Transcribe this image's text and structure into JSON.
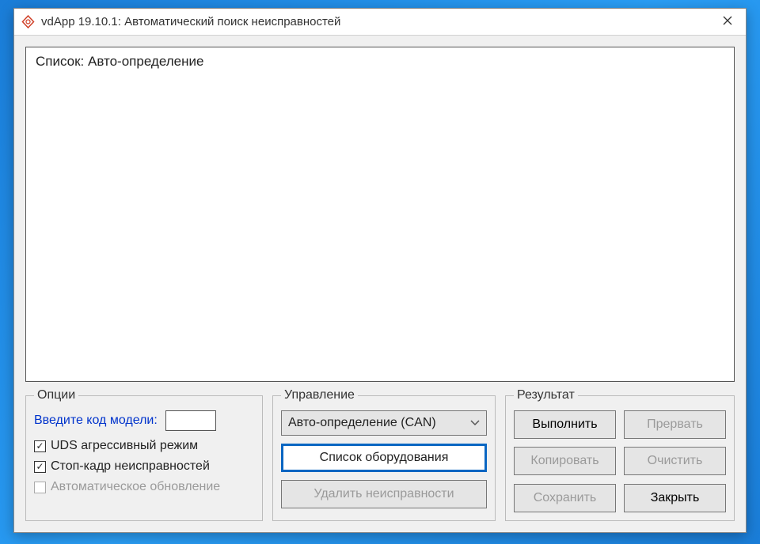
{
  "window": {
    "title": "vdApp 19.10.1:  Автоматический поиск неисправностей"
  },
  "list": {
    "header": "Список: Авто-определение"
  },
  "options": {
    "legend": "Опции",
    "model_label": "Введите код модели:",
    "model_value": "",
    "chk_uds": "UDS агрессивный режим",
    "chk_stopframe": "Стоп-кадр неисправностей",
    "chk_autoupdate": "Автоматическое обновление"
  },
  "control": {
    "legend": "Управление",
    "dropdown_value": "Авто-определение (CAN)",
    "btn_equipment": "Список оборудования",
    "btn_delete": "Удалить неисправности"
  },
  "result": {
    "legend": "Результат",
    "btn_execute": "Выполнить",
    "btn_abort": "Прервать",
    "btn_copy": "Копировать",
    "btn_clear": "Очистить",
    "btn_save": "Сохранить",
    "btn_close": "Закрыть"
  }
}
